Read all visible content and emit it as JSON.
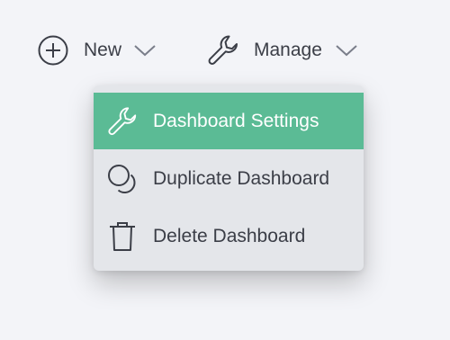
{
  "toolbar": {
    "new_label": "New",
    "manage_label": "Manage"
  },
  "menu": {
    "items": [
      {
        "label": "Dashboard Settings",
        "icon": "wrench-icon",
        "active": true
      },
      {
        "label": "Duplicate Dashboard",
        "icon": "duplicate-icon",
        "active": false
      },
      {
        "label": "Delete Dashboard",
        "icon": "trash-icon",
        "active": false
      }
    ]
  },
  "colors": {
    "background": "#f3f4f8",
    "menu_background": "#e4e6ea",
    "active_item": "#5bbb95",
    "text": "#3b3e47"
  }
}
